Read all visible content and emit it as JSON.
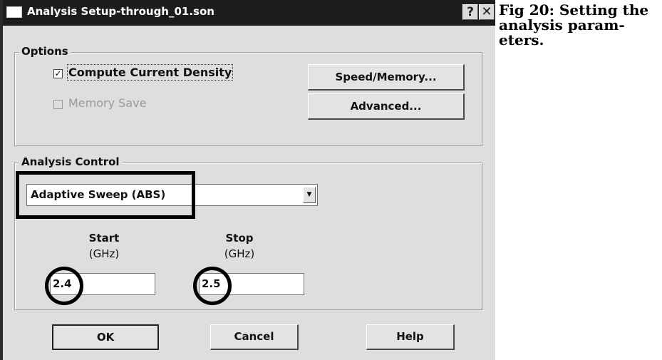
{
  "window": {
    "title": "Analysis Setup-through_01.son",
    "help_glyph": "?",
    "close_glyph": "✕",
    "title_icon": "window-icon"
  },
  "options": {
    "legend": "Options",
    "compute_current_density": {
      "label": "Compute Current Density",
      "checked": true,
      "check_glyph": "✓"
    },
    "memory_save": {
      "label": "Memory Save",
      "checked": false,
      "enabled": false
    },
    "speed_memory_label": "Speed/Memory...",
    "advanced_label": "Advanced..."
  },
  "analysis_control": {
    "legend": "Analysis Control",
    "sweep_type": "Adaptive Sweep (ABS)",
    "dropdown_glyph": "▼",
    "start": {
      "label": "Start",
      "unit": "(GHz)",
      "value": "2.4"
    },
    "stop": {
      "label": "Stop",
      "unit": "(GHz)",
      "value": "2.5"
    }
  },
  "buttons": {
    "ok": "OK",
    "cancel": "Cancel",
    "help": "Help"
  },
  "caption": "Fig 20: Setting the analysis param- eters.",
  "colors": {
    "titlebar": "#1c1c1c",
    "dialog_bg": "#dedede",
    "annotation": "#000000"
  }
}
